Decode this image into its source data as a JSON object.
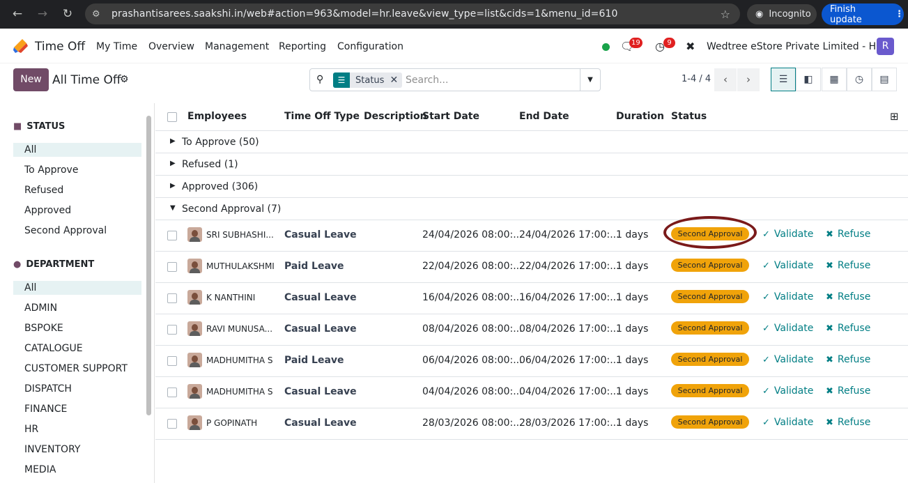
{
  "browser": {
    "url": "prashantisarees.saakshi.in/web#action=963&model=hr.leave&view_type=list&cids=1&menu_id=610",
    "incognito_label": "Incognito",
    "finish_update_label": "Finish update"
  },
  "navbar": {
    "app_name": "Time Off",
    "menu": [
      "My Time",
      "Overview",
      "Management",
      "Reporting",
      "Configuration"
    ],
    "chat_badge": "19",
    "activity_badge": "9",
    "company": "Wedtree eStore Private Limited - HO",
    "user_initial": "R"
  },
  "control": {
    "new_label": "New",
    "title": "All Time Off",
    "facet_label": "Status",
    "search_placeholder": "Search...",
    "pager": "1-4 / 4"
  },
  "sidebar": {
    "status_heading": "STATUS",
    "status_items": [
      "All",
      "To Approve",
      "Refused",
      "Approved",
      "Second Approval"
    ],
    "department_heading": "DEPARTMENT",
    "department_items": [
      "All",
      "ADMIN",
      "BSPOKE",
      "CATALOGUE",
      "CUSTOMER SUPPORT",
      "DISPATCH",
      "FINANCE",
      "HR",
      "INVENTORY",
      "MEDIA"
    ]
  },
  "table": {
    "columns": [
      "Employees",
      "Time Off Type",
      "Description",
      "Start Date",
      "End Date",
      "Duration",
      "Status"
    ],
    "groups": [
      "To Approve (50)",
      "Refused (1)",
      "Approved (306)",
      "Second Approval (7)"
    ],
    "rows": [
      {
        "employee": "SRI SUBHASHI...",
        "type": "Casual Leave",
        "start": "24/04/2026 08:00:...",
        "end": "24/04/2026 17:00:...",
        "duration": "1 days",
        "status": "Second Approval"
      },
      {
        "employee": "MUTHULAKSHMI",
        "type": "Paid Leave",
        "start": "22/04/2026 08:00:...",
        "end": "22/04/2026 17:00:...",
        "duration": "1 days",
        "status": "Second Approval"
      },
      {
        "employee": "K NANTHINI",
        "type": "Casual Leave",
        "start": "16/04/2026 08:00:...",
        "end": "16/04/2026 17:00:...",
        "duration": "1 days",
        "status": "Second Approval"
      },
      {
        "employee": "RAVI MUNUSA...",
        "type": "Casual Leave",
        "start": "08/04/2026 08:00:...",
        "end": "08/04/2026 17:00:...",
        "duration": "1 days",
        "status": "Second Approval"
      },
      {
        "employee": "MADHUMITHA S",
        "type": "Paid Leave",
        "start": "06/04/2026 08:00:...",
        "end": "06/04/2026 17:00:...",
        "duration": "1 days",
        "status": "Second Approval"
      },
      {
        "employee": "MADHUMITHA S",
        "type": "Casual Leave",
        "start": "04/04/2026 08:00:...",
        "end": "04/04/2026 17:00:...",
        "duration": "1 days",
        "status": "Second Approval"
      },
      {
        "employee": "P GOPINATH",
        "type": "Casual Leave",
        "start": "28/03/2026 08:00:...",
        "end": "28/03/2026 17:00:...",
        "duration": "1 days",
        "status": "Second Approval"
      }
    ],
    "validate_label": "Validate",
    "refuse_label": "Refuse"
  },
  "colors": {
    "brand": "#714b67",
    "accent": "#017e84",
    "status_pill": "#f0a30a",
    "annotation_circle": "#7a1a1a"
  }
}
